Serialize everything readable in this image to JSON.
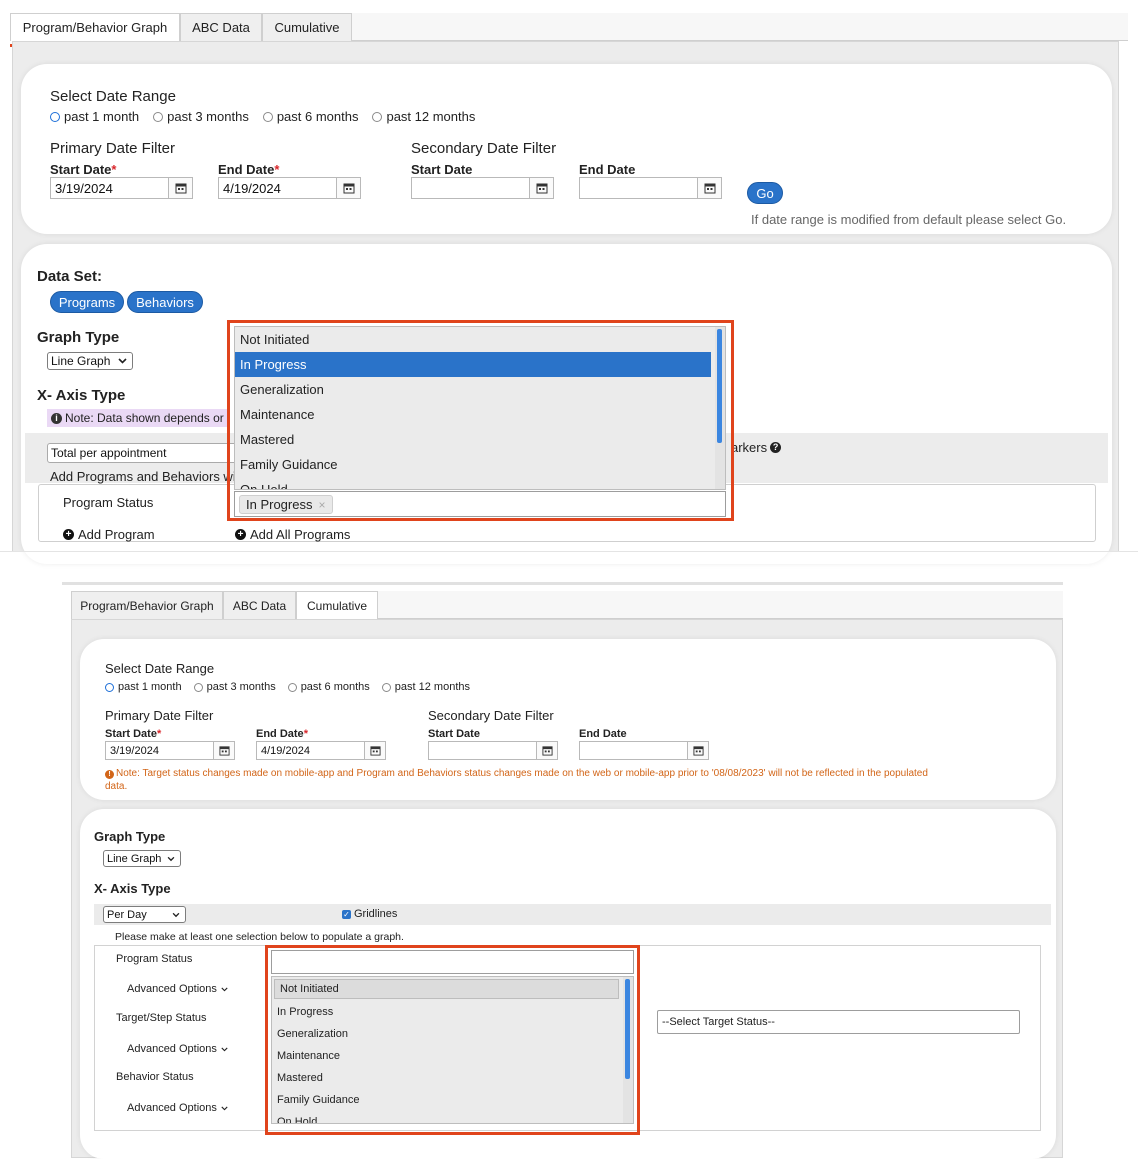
{
  "top": {
    "tabs": [
      {
        "label": "Program/Behavior Graph",
        "active": true
      },
      {
        "label": "ABC Data",
        "active": false
      },
      {
        "label": "Cumulative",
        "active": false
      }
    ],
    "date_range": {
      "title": "Select Date Range",
      "options": [
        "past 1 month",
        "past 3 months",
        "past 6 months",
        "past 12 months"
      ],
      "selected": "past 1 month"
    },
    "primary_filter": {
      "title": "Primary Date Filter",
      "start_label": "Start Date",
      "start_value": "3/19/2024",
      "end_label": "End Date",
      "end_value": "4/19/2024",
      "required_mark": "*"
    },
    "secondary_filter": {
      "title": "Secondary Date Filter",
      "start_label": "Start Date",
      "start_value": "",
      "end_label": "End Date",
      "end_value": ""
    },
    "go_label": "Go",
    "go_hint": "If date range is modified from default please select Go.",
    "data_set": {
      "title": "Data Set:",
      "buttons": [
        "Programs",
        "Behaviors"
      ]
    },
    "graph_type": {
      "title": "Graph Type",
      "value": "Line Graph"
    },
    "x_axis": {
      "title": "X- Axis Type",
      "note": "Note: Data shown depends or",
      "value": "Total per appointment",
      "markers_text": "arkers",
      "add_text": "Add Programs and Behaviors wi"
    },
    "program_status": {
      "label": "Program Status",
      "selected_tag": "In Progress",
      "tag_close": "×",
      "add_program": "Add Program",
      "add_all": "Add All Programs"
    },
    "dropdown_options": [
      "Not Initiated",
      "In Progress",
      "Generalization",
      "Maintenance",
      "Mastered",
      "Family Guidance",
      "On Hold"
    ],
    "dropdown_selected": "In Progress"
  },
  "bottom": {
    "tabs": [
      {
        "label": "Program/Behavior Graph",
        "active": false
      },
      {
        "label": "ABC Data",
        "active": false
      },
      {
        "label": "Cumulative",
        "active": true
      }
    ],
    "date_range": {
      "title": "Select Date Range",
      "options": [
        "past 1 month",
        "past 3 months",
        "past 6 months",
        "past 12 months"
      ],
      "selected": "past 1 month"
    },
    "primary_filter": {
      "title": "Primary Date Filter",
      "start_label": "Start Date",
      "start_value": "3/19/2024",
      "end_label": "End Date",
      "end_value": "4/19/2024",
      "required_mark": "*"
    },
    "secondary_filter": {
      "title": "Secondary Date Filter",
      "start_label": "Start Date",
      "start_value": "",
      "end_label": "End Date",
      "end_value": ""
    },
    "note_line1": "Note: Target status changes made on mobile-app and Program and Behaviors status changes made on the web or mobile-app prior to '08/08/2023' will not be reflected in the populated",
    "note_line2": "data.",
    "graph_type": {
      "title": "Graph Type",
      "value": "Line Graph"
    },
    "x_axis": {
      "title": "X- Axis Type",
      "value": "Per Day"
    },
    "gridlines": {
      "label": "Gridlines",
      "checked": true
    },
    "instruction": "Please make at least one selection below to populate a graph.",
    "program_status_label": "Program Status",
    "advanced_options": "Advanced Options",
    "target_status_label": "Target/Step Status",
    "target_status_placeholder": "--Select Target Status--",
    "behavior_status_label": "Behavior Status",
    "search_value": "",
    "dropdown_options": [
      "Not Initiated",
      "In Progress",
      "Generalization",
      "Maintenance",
      "Mastered",
      "Family Guidance",
      "On Hold"
    ],
    "dropdown_highlighted": "Not Initiated"
  },
  "colors": {
    "accent_red": "#e0441c",
    "primary_blue": "#2a73c9",
    "note_orange": "#d26518"
  }
}
